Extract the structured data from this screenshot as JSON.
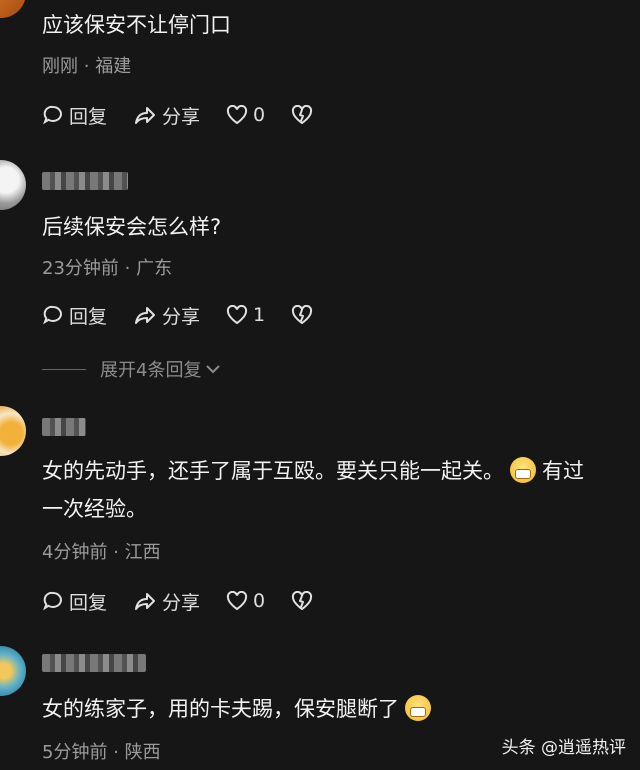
{
  "comments": [
    {
      "text": "应该保安不让停门口",
      "time": "刚刚",
      "location": "福建",
      "reply": "回复",
      "share": "分享",
      "likes": "0"
    },
    {
      "text": "后续保安会怎么样?",
      "time": "23分钟前",
      "location": "广东",
      "reply": "回复",
      "share": "分享",
      "likes": "1",
      "expand": "展开4条回复"
    },
    {
      "text_line1": "女的先动手，还手了属于互殴。要关只能一起关。",
      "text_line1b": "有过",
      "text_line2": "一次经验。",
      "time": "4分钟前",
      "location": "江西",
      "reply": "回复",
      "share": "分享",
      "likes": "0"
    },
    {
      "text": "女的练家子，用的卡夫踢，保安腿断了",
      "time": "5分钟前",
      "location": "陕西"
    }
  ],
  "separator": "·",
  "watermark": "头条 @逍遥热评"
}
